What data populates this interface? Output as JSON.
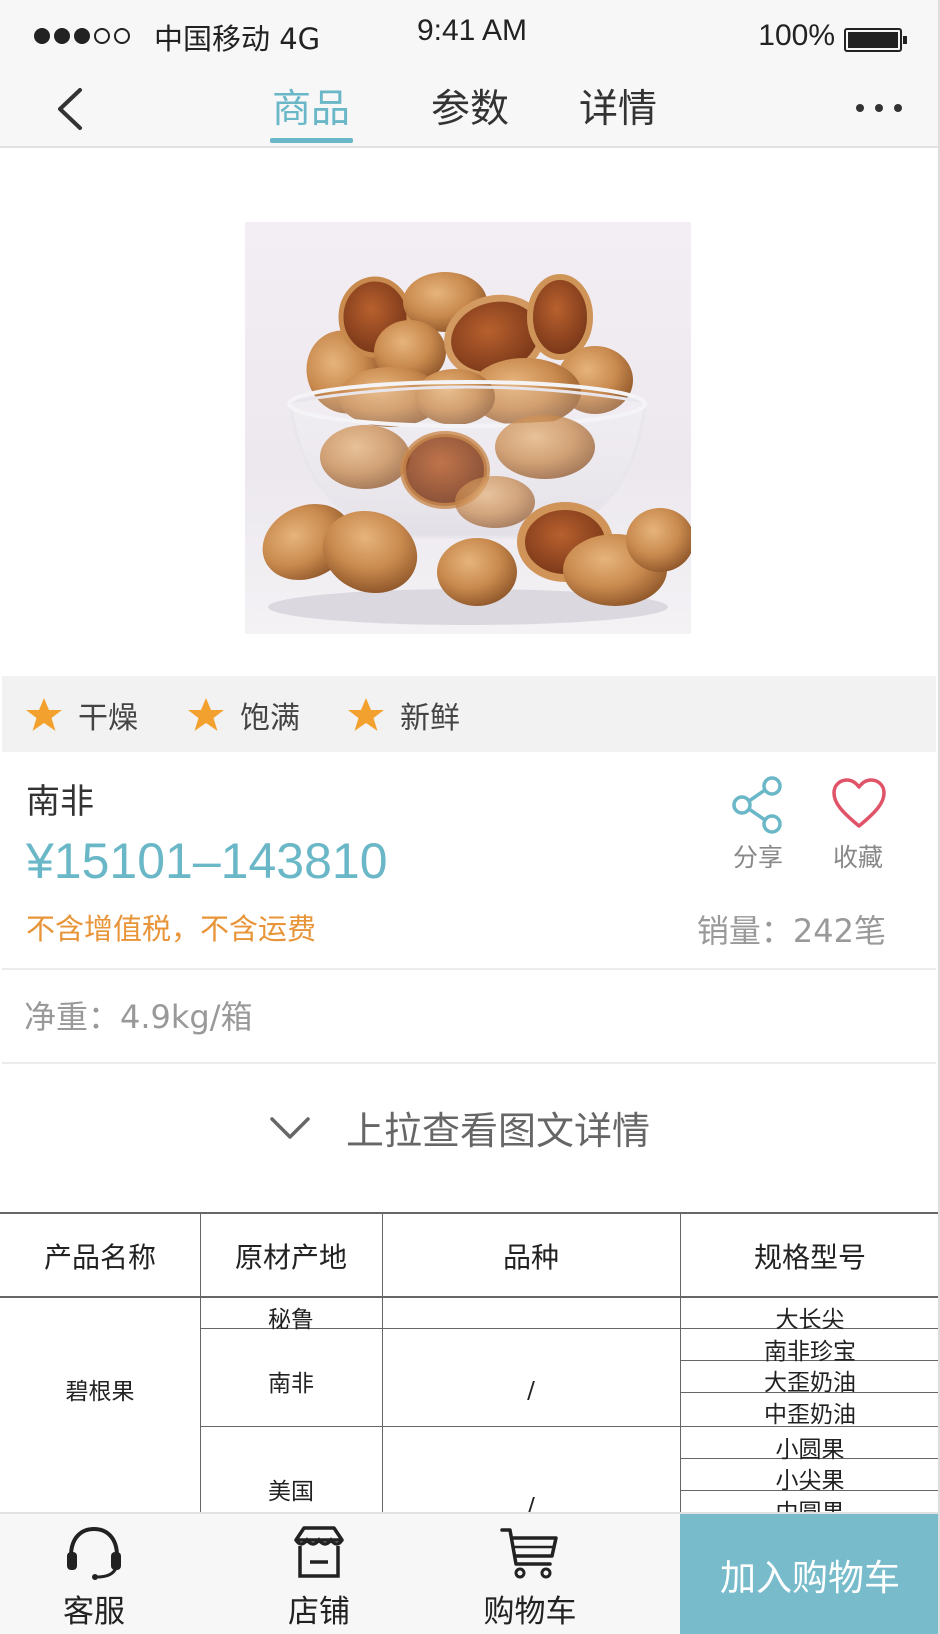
{
  "status_bar": {
    "carrier": "中国移动 4G",
    "time": "9:41 AM",
    "battery": "100%",
    "signal_bars_filled": 3,
    "signal_bars_total": 5
  },
  "nav": {
    "tabs": [
      {
        "label": "商品",
        "active": true
      },
      {
        "label": "参数",
        "active": false
      },
      {
        "label": "详情",
        "active": false
      }
    ],
    "back_icon": "chevron-left-icon",
    "more_icon": "more-icon"
  },
  "features": [
    {
      "label": "干燥",
      "icon": "star-icon"
    },
    {
      "label": "饱满",
      "icon": "star-icon"
    },
    {
      "label": "新鲜",
      "icon": "star-icon"
    }
  ],
  "product": {
    "name": "南非",
    "price": "¥15101–143810",
    "tax_note": "不含增值税，不含运费",
    "sales": "销量：242笔",
    "net_weight": "净重：4.9kg/箱"
  },
  "actions": {
    "share_label": "分享",
    "favorite_label": "收藏"
  },
  "pull_up_hint": "上拉查看图文详情",
  "spec_table": {
    "headers": [
      "产品名称",
      "原材产地",
      "品种",
      "规格型号"
    ],
    "product_name": "碧根果",
    "origins": [
      "秘鲁",
      "南非",
      "美国"
    ],
    "variety_placeholder": "/",
    "variety_placeholder_2": "/",
    "models": [
      "大长尖",
      "南非珍宝",
      "大歪奶油",
      "中歪奶油",
      "小圆果",
      "小尖果",
      "中圆果"
    ]
  },
  "bottom_bar": {
    "service_label": "客服",
    "store_label": "店铺",
    "cart_label": "购物车",
    "add_to_cart_label": "加入购物车"
  },
  "colors": {
    "accent": "#6ab7c7",
    "warning": "#e8953a",
    "star": "#f2a12e",
    "heart": "#e0546a",
    "cta": "#78bccc"
  }
}
